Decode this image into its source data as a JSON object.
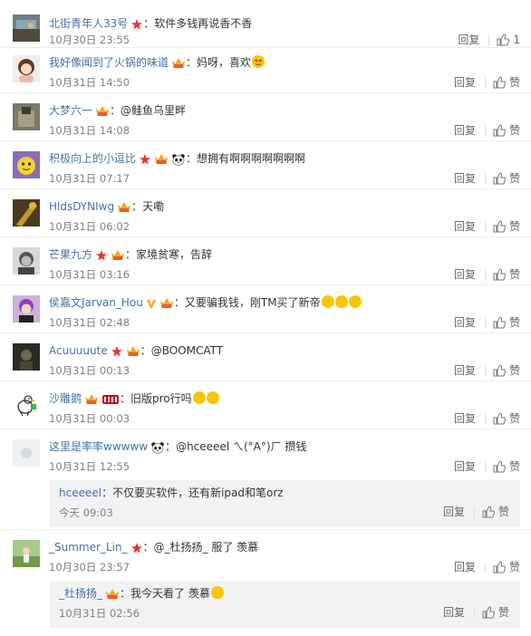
{
  "reply_label": "回复",
  "like_label": "赞",
  "colors": {
    "username": "#4a6fa5",
    "time": "#808080",
    "sub_bg": "#f2f2f5",
    "separator": "#ebebeb"
  },
  "comments": [
    {
      "user": "北街青年人33号",
      "text": "：软件多钱再说香不香",
      "time": "10月30日 23:55",
      "likes": "1",
      "badges": [
        "star-badge"
      ]
    },
    {
      "user": "我好像闻到了火锅的味道",
      "text": "：妈呀，喜欢",
      "time": "10月31日 14:50",
      "badges": [
        "crown-badge",
        "heart-eyes-emoji"
      ]
    },
    {
      "user": "大梦六一",
      "text": "：@鲑鱼乌里畔",
      "time": "10月31日 14:08",
      "badges": [
        "crown-badge"
      ]
    },
    {
      "user": "积极向上的小逗比",
      "text": "：想拥有啊啊啊啊啊啊啊",
      "time": "10月31日 07:17",
      "badges": [
        "star-badge",
        "crown-badge",
        "panda-badge"
      ]
    },
    {
      "user": "HldsDYNIwg",
      "text": "：天嘞",
      "time": "10月31日 06:02",
      "badges": [
        "crown-badge"
      ]
    },
    {
      "user": "芒果九方",
      "text": "：家境贫寒，告辞",
      "time": "10月31日 03:16",
      "badges": [
        "star-badge",
        "crown-badge",
        "fist-emoji"
      ]
    },
    {
      "user": "侯嘉文Jarvan_Hou",
      "text": "：又要骗我钱，刚TM买了新帝",
      "time": "10月31日 02:48",
      "badges": [
        "verified-v-badge",
        "crown-badge",
        "cry-emoji-x3"
      ]
    },
    {
      "user": "Acuuuuute",
      "text": "：@BOOMCATT",
      "time": "10月31日 00:13",
      "badges": [
        "star-badge",
        "crown-badge"
      ]
    },
    {
      "user": "沙雕鹅",
      "text": "：旧版pro行吗",
      "time": "10月31日 00:03",
      "badges": [
        "crown-badge",
        "level-badge",
        "pleading-emoji-x2"
      ]
    },
    {
      "user": "这里是率率wwwww",
      "text": "：@hceeeel  ㄟ(°A°)ㄏ 攒钱",
      "time": "10月31日 12:55",
      "badges": [
        "panda-badge"
      ]
    },
    {
      "user": "hceeeel",
      "text": "：不仅要买软件，还有新ipad和笔orz",
      "time": "今天 09:03",
      "sub": true,
      "badges": []
    },
    {
      "user": "_Summer_Lin_",
      "text": "：@_杜扬扬_ 服了 羡慕",
      "time": "10月30日 23:57",
      "badges": [
        "star-badge"
      ]
    },
    {
      "user": "_杜扬扬_",
      "text": "：我今天看了 羡慕",
      "time": "10月31日 02:56",
      "sub": true,
      "badges": [
        "crown-badge",
        "pleading-emoji"
      ]
    }
  ]
}
